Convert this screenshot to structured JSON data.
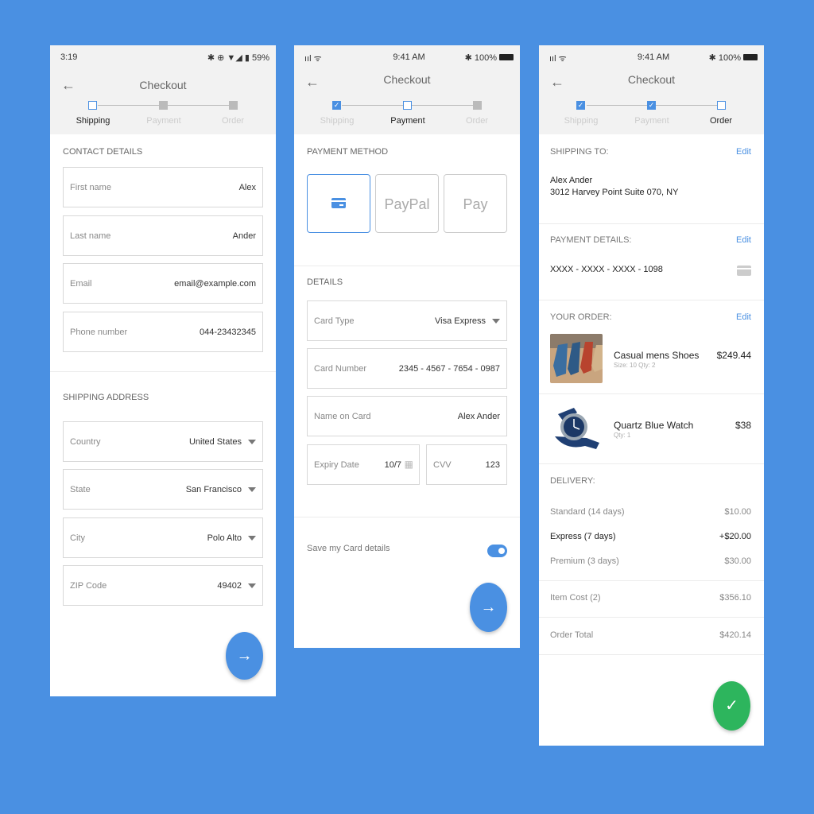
{
  "colors": {
    "background": "#4a90e2",
    "accent": "#4a90e2",
    "success": "#2db55d"
  },
  "shipping_screen": {
    "status": {
      "time": "3:19",
      "icons": "✱ ⊕ ▼◢ ▮",
      "battery": "59%"
    },
    "title": "Checkout",
    "steps": [
      "Shipping",
      "Payment",
      "Order"
    ],
    "contact_label": "CONTACT DETAILS",
    "contact_fields": [
      {
        "label": "First name",
        "value": "Alex"
      },
      {
        "label": "Last name",
        "value": "Ander"
      },
      {
        "label": "Email",
        "value": "email@example.com"
      },
      {
        "label": "Phone number",
        "value": "044-23432345"
      }
    ],
    "address_label": "SHIPPING ADDRESS",
    "address_fields": [
      {
        "label": "Country",
        "value": "United States"
      },
      {
        "label": "State",
        "value": "San Francisco"
      },
      {
        "label": "City",
        "value": "Polo Alto"
      },
      {
        "label": "ZIP Code",
        "value": "49402"
      }
    ],
    "next_icon": "→"
  },
  "payment_screen": {
    "status": {
      "signal": "ııl ᯤ",
      "time": "9:41 AM",
      "battery": "✱ 100%"
    },
    "title": "Checkout",
    "steps": [
      "Shipping",
      "Payment",
      "Order"
    ],
    "method_label": "PAYMENT METHOD",
    "methods": {
      "paypal": "PayPal",
      "applepay": "Pay",
      "apple_glyph": ""
    },
    "details_label": "DETAILS",
    "card_type": {
      "label": "Card Type",
      "value": "Visa Express"
    },
    "card_number": {
      "label": "Card Number",
      "value": "2345 - 4567 - 7654 - 0987"
    },
    "name_on_card": {
      "label": "Name on Card",
      "value": "Alex Ander"
    },
    "expiry": {
      "label": "Expiry Date",
      "value": "10/7"
    },
    "cvv": {
      "label": "CVV",
      "value": "123"
    },
    "save_card_label": "Save my Card details",
    "save_card_on": true,
    "next_icon": "→"
  },
  "order_screen": {
    "status": {
      "signal": "ııl ᯤ",
      "time": "9:41 AM",
      "battery": "✱ 100%"
    },
    "title": "Checkout",
    "steps": [
      "Shipping",
      "Payment",
      "Order"
    ],
    "shipping_to_label": "SHIPPING TO:",
    "edit_label": "Edit",
    "ship_name": "Alex Ander",
    "ship_address": "3012 Harvey Point Suite 070, NY",
    "payment_label": "PAYMENT DETAILS:",
    "card_masked": "XXXX - XXXX - XXXX - 1098",
    "order_label": "YOUR ORDER:",
    "items": [
      {
        "name": "Casual mens Shoes",
        "meta": "Size: 10   Qty: 2",
        "price": "$249.44"
      },
      {
        "name": "Quartz Blue Watch",
        "meta": "Qty: 1",
        "price": "$38"
      }
    ],
    "delivery_label": "DELIVERY:",
    "delivery_options": [
      {
        "name": "Standard (14 days)",
        "price": "$10.00"
      },
      {
        "name": "Express (7 days)",
        "price": "+$20.00"
      },
      {
        "name": "Premium (3 days)",
        "price": "$30.00"
      }
    ],
    "item_cost": {
      "label": "Item Cost (2)",
      "value": "$356.10"
    },
    "order_total": {
      "label": "Order Total",
      "value": "$420.14"
    },
    "confirm_icon": "✓"
  }
}
